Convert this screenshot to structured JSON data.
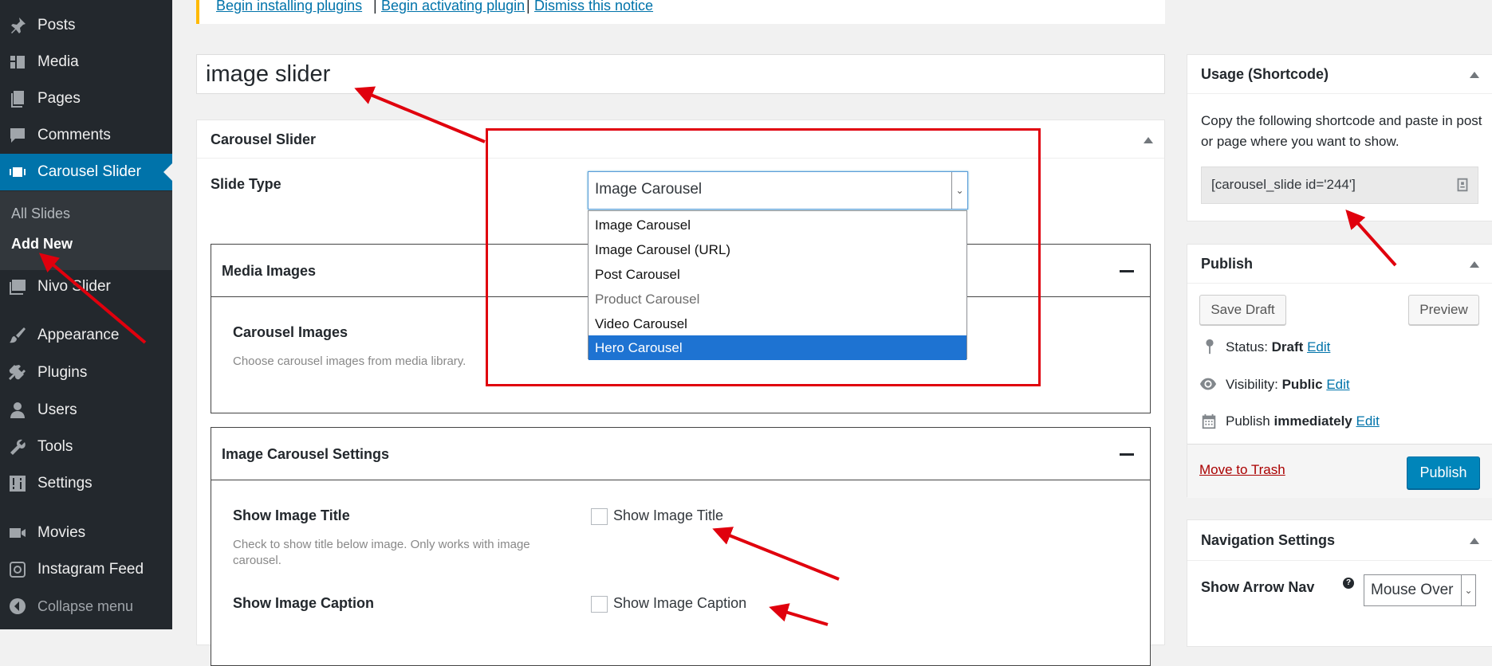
{
  "sidebar": {
    "items": [
      {
        "label": "Posts",
        "icon": "pin-icon"
      },
      {
        "label": "Media",
        "icon": "media-icon"
      },
      {
        "label": "Pages",
        "icon": "pages-icon"
      },
      {
        "label": "Comments",
        "icon": "comment-icon"
      },
      {
        "label": "Carousel Slider",
        "icon": "slides-icon",
        "active": true
      },
      {
        "label": "Nivo Slider",
        "icon": "images-icon"
      },
      {
        "label": "Appearance",
        "icon": "brush-icon"
      },
      {
        "label": "Plugins",
        "icon": "plug-icon"
      },
      {
        "label": "Users",
        "icon": "user-icon"
      },
      {
        "label": "Tools",
        "icon": "wrench-icon"
      },
      {
        "label": "Settings",
        "icon": "settings-icon"
      },
      {
        "label": "Movies",
        "icon": "video-icon"
      },
      {
        "label": "Instagram Feed",
        "icon": "instagram-icon"
      },
      {
        "label": "Collapse menu",
        "icon": "collapse-icon"
      }
    ],
    "submenu": [
      {
        "label": "All Slides"
      },
      {
        "label": "Add New",
        "current": true
      }
    ]
  },
  "notice": {
    "links": [
      "Begin installing plugins",
      "Begin activating plugin",
      "Dismiss this notice"
    ],
    "separator": "|"
  },
  "post_title": "image slider",
  "carousel_box": {
    "title": "Carousel Slider",
    "slide_type_label": "Slide Type",
    "slide_type_value": "Image Carousel",
    "options": [
      "Image Carousel",
      "Image Carousel (URL)",
      "Post Carousel",
      "Product Carousel",
      "Video Carousel",
      "Hero Carousel"
    ],
    "highlighted_option": "Hero Carousel",
    "media_images": {
      "title": "Media Images",
      "field_label": "Carousel Images",
      "field_desc": "Choose carousel images from media library."
    },
    "settings": {
      "title": "Image Carousel Settings",
      "show_title": {
        "label": "Show Image Title",
        "desc": "Check to show title below image. Only works with image carousel.",
        "checkbox_label": "Show Image Title",
        "checked": false
      },
      "show_caption": {
        "label": "Show Image Caption",
        "checkbox_label": "Show Image Caption",
        "checked": false
      }
    }
  },
  "usage_box": {
    "title": "Usage (Shortcode)",
    "desc": "Copy the following shortcode and paste in post or page where you want to show.",
    "shortcode": "[carousel_slide id='244']"
  },
  "publish_box": {
    "title": "Publish",
    "save_draft": "Save Draft",
    "preview": "Preview",
    "status_label": "Status:",
    "status_value": "Draft",
    "visibility_label": "Visibility:",
    "visibility_value": "Public",
    "publish_label": "Publish",
    "publish_value": "immediately",
    "edit": "Edit",
    "trash": "Move to Trash",
    "publish_button": "Publish"
  },
  "nav_box": {
    "title": "Navigation Settings",
    "arrow_label": "Show Arrow Nav",
    "arrow_value": "Mouse Over",
    "help": "?"
  },
  "colors": {
    "sidebar_bg": "#23282d",
    "active_blue": "#0073aa",
    "notice_border": "#ffb900",
    "annotation_red": "#e0000d",
    "selected_option": "#1e73d2"
  }
}
